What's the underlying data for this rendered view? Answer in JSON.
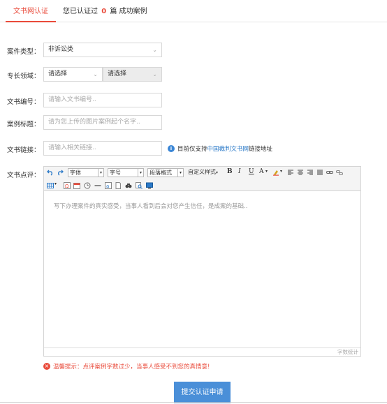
{
  "tabs": {
    "active": "文书网认证",
    "info_prefix": "您已认证过",
    "info_count": "0",
    "info_suffix": "篇 成功案例"
  },
  "form": {
    "case_type_label": "案件类型：",
    "case_type_value": "非诉讼类",
    "specialty_label": "专长领域：",
    "specialty_select1": "请选择",
    "specialty_select2": "请选择",
    "doc_number_label": "文书编号：",
    "doc_number_placeholder": "请输入文书编号..",
    "case_title_label": "案例标题：",
    "case_title_placeholder": "请为您上传的图片案例起个名字..",
    "doc_link_label": "文书链接：",
    "doc_link_placeholder": "请输入相关链接..",
    "doc_link_note_prefix": "目前仅支持",
    "doc_link_note_link": "中国裁判文书网",
    "doc_link_note_suffix": "链接地址",
    "review_label": "文书点评："
  },
  "editor": {
    "font_family": "字体",
    "font_size": "字号",
    "paragraph": "段落格式",
    "custom_style": "自定义样式",
    "bold": "B",
    "italic": "I",
    "underline": "U",
    "font_color": "A",
    "placeholder": "写下办理案件的真实感受，当事人看到后会对您产生信任，是成案的基础..",
    "word_count": "字数统计"
  },
  "warning": "温馨提示：点评案例字数过少，当事人感受不到您的真情意!",
  "submit_label": "提交认证申请",
  "colors": {
    "accent_red": "#e94a3a",
    "primary_blue": "#4a8fd8",
    "link_blue": "#2a79c8"
  }
}
